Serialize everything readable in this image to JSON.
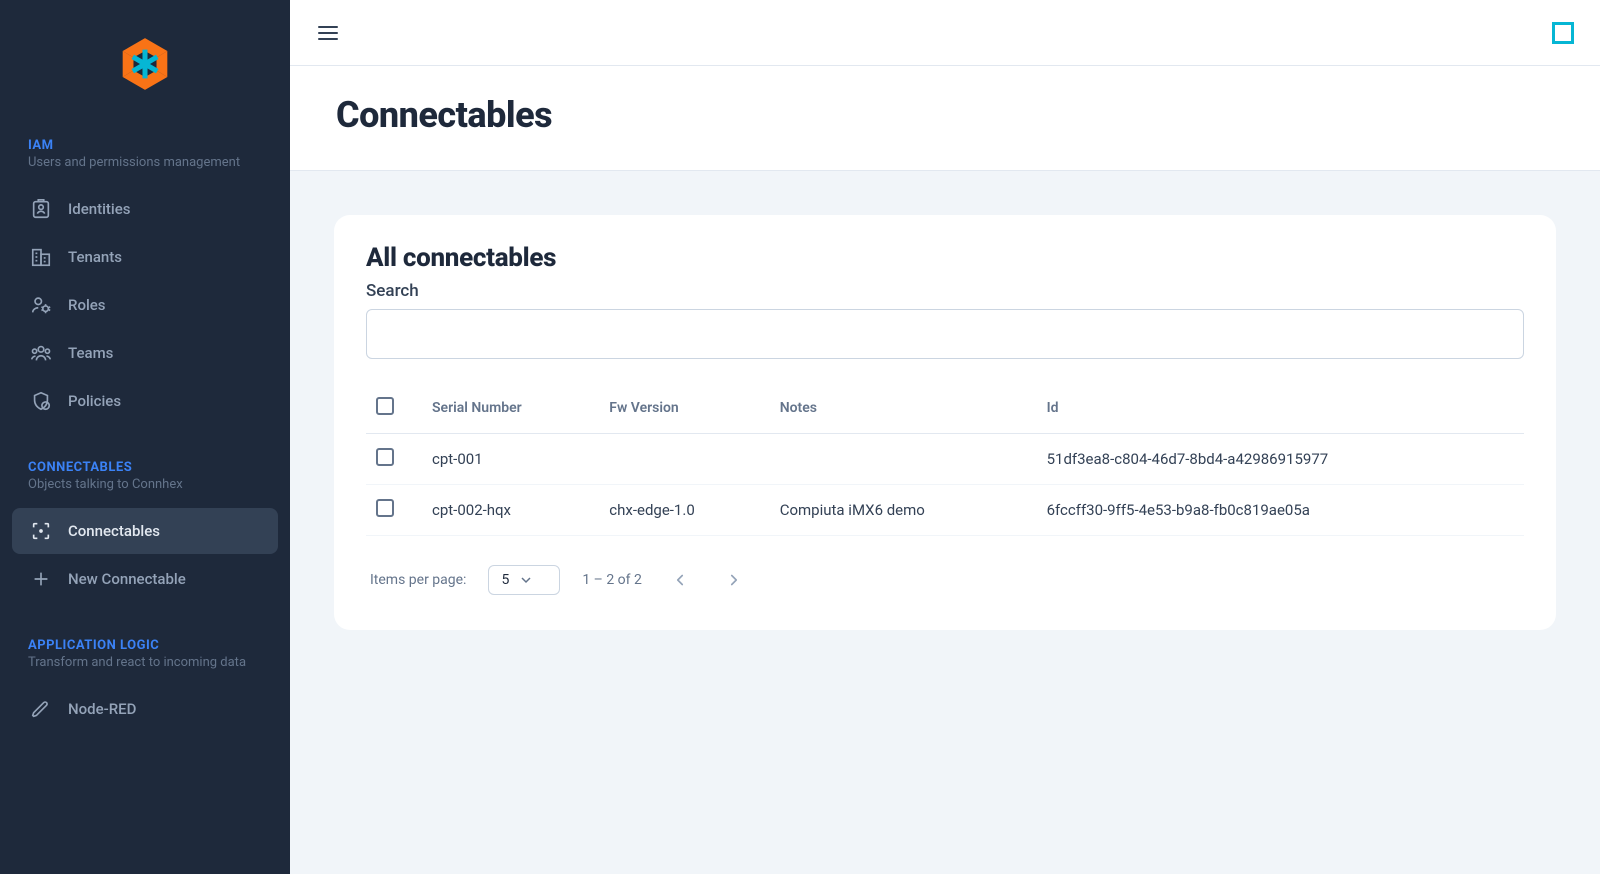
{
  "sidebar": {
    "sections": [
      {
        "title": "IAM",
        "subtitle": "Users and permissions management",
        "items": [
          {
            "label": "Identities",
            "icon": "id-card",
            "active": false
          },
          {
            "label": "Tenants",
            "icon": "building",
            "active": false
          },
          {
            "label": "Roles",
            "icon": "user-cog",
            "active": false
          },
          {
            "label": "Teams",
            "icon": "users",
            "active": false
          },
          {
            "label": "Policies",
            "icon": "shield",
            "active": false
          }
        ]
      },
      {
        "title": "CONNECTABLES",
        "subtitle": "Objects talking to Connhex",
        "items": [
          {
            "label": "Connectables",
            "icon": "scan",
            "active": true
          },
          {
            "label": "New Connectable",
            "icon": "plus",
            "active": false
          }
        ]
      },
      {
        "title": "APPLICATION LOGIC",
        "subtitle": "Transform and react to incoming data",
        "items": [
          {
            "label": "Node-RED",
            "icon": "pencil",
            "active": false
          }
        ]
      }
    ]
  },
  "page": {
    "title": "Connectables",
    "card_title": "All connectables",
    "search_label": "Search",
    "search_value": ""
  },
  "table": {
    "columns": [
      "Serial Number",
      "Fw Version",
      "Notes",
      "Id"
    ],
    "rows": [
      {
        "serial": "cpt-001",
        "fw": "",
        "notes": "",
        "id": "51df3ea8-c804-46d7-8bd4-a42986915977"
      },
      {
        "serial": "cpt-002-hqx",
        "fw": "chx-edge-1.0",
        "notes": "Compiuta iMX6 demo",
        "id": "6fccff30-9ff5-4e53-b9a8-fb0c819ae05a"
      }
    ]
  },
  "pagination": {
    "items_per_page_label": "Items per page:",
    "items_per_page_value": "5",
    "range_text": "1 – 2 of 2"
  }
}
